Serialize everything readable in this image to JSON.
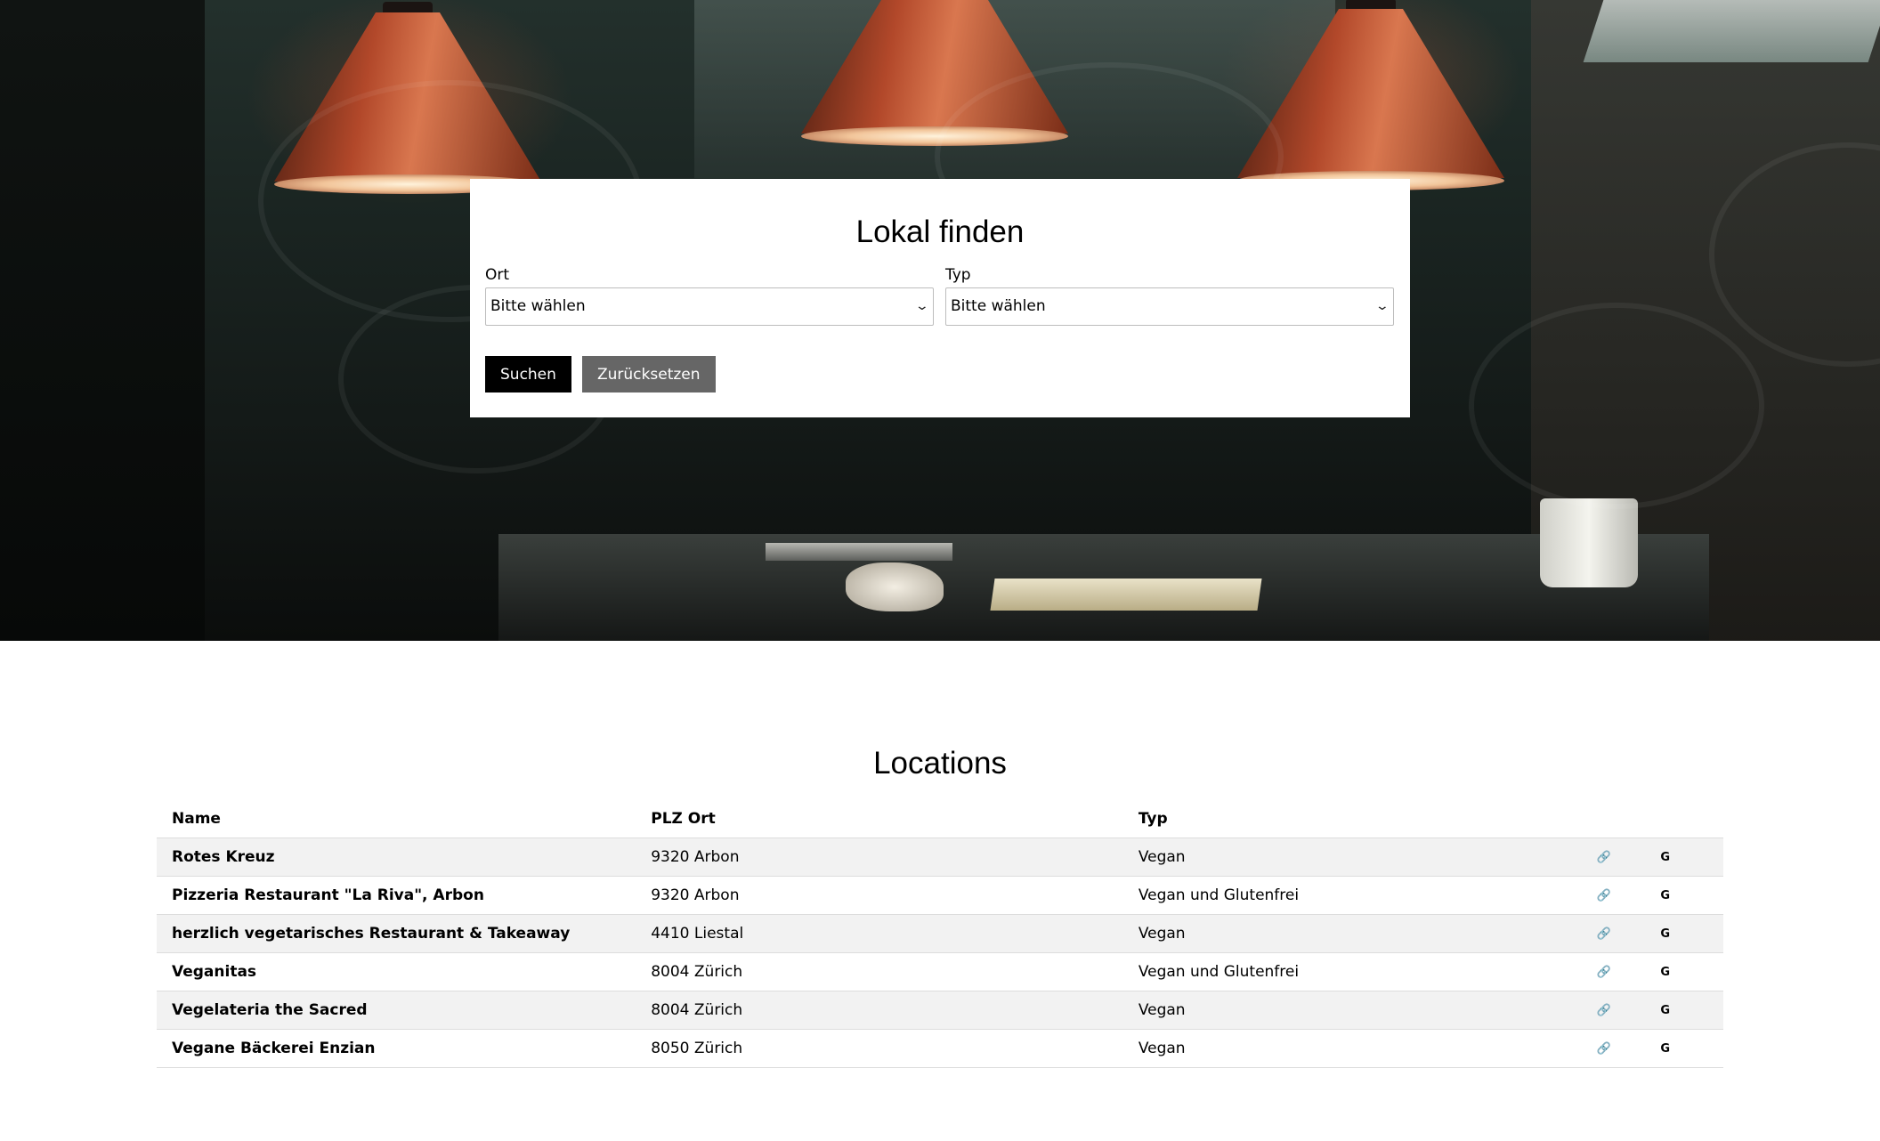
{
  "search": {
    "title": "Lokal finden",
    "ort_label": "Ort",
    "ort_value": "Bitte wählen",
    "typ_label": "Typ",
    "typ_value": "Bitte wählen",
    "search_button": "Suchen",
    "reset_button": "Zurücksetzen"
  },
  "locations": {
    "title": "Locations",
    "headers": {
      "name": "Name",
      "plz_ort": "PLZ Ort",
      "typ": "Typ"
    },
    "rows": [
      {
        "name": "Rotes Kreuz",
        "plz_ort": "9320 Arbon",
        "typ": "Vegan",
        "link_icon": "🔗",
        "google": "G"
      },
      {
        "name": "Pizzeria Restaurant \"La Riva\", Arbon",
        "plz_ort": "9320 Arbon",
        "typ": "Vegan und Glutenfrei",
        "link_icon": "🔗",
        "google": "G"
      },
      {
        "name": "herzlich vegetarisches Restaurant & Takeaway",
        "plz_ort": "4410 Liestal",
        "typ": "Vegan",
        "link_icon": "🔗",
        "google": "G"
      },
      {
        "name": "Veganitas",
        "plz_ort": "8004 Zürich",
        "typ": "Vegan und Glutenfrei",
        "link_icon": "🔗",
        "google": "G"
      },
      {
        "name": "Vegelateria the Sacred",
        "plz_ort": "8004 Zürich",
        "typ": "Vegan",
        "link_icon": "🔗",
        "google": "G"
      },
      {
        "name": "Vegane Bäckerei Enzian",
        "plz_ort": "8050 Zürich",
        "typ": "Vegan",
        "link_icon": "🔗",
        "google": "G"
      }
    ]
  },
  "icons": {
    "select_chevron": "chevron-down-icon",
    "link": "link-icon",
    "google": "google-icon"
  },
  "colors": {
    "search_button_bg": "#000000",
    "reset_button_bg": "#666666",
    "row_stripe": "#f2f2f2"
  }
}
